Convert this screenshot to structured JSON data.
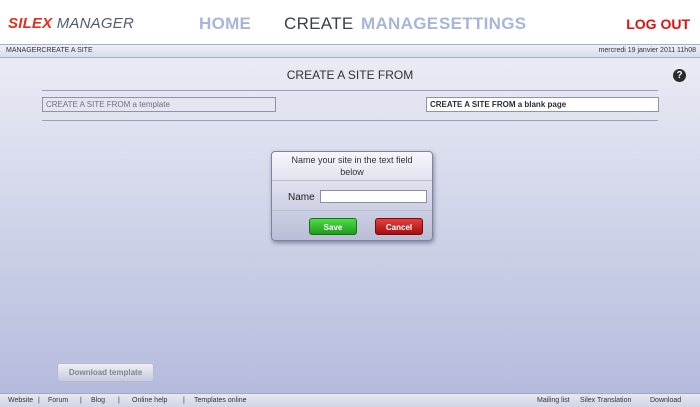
{
  "header": {
    "logo_part1": "SILEX",
    "logo_part2": "MANAGER",
    "nav": {
      "home": "HOME",
      "create": "CREATE",
      "manage": "MANAGE",
      "settings": "SETTINGS"
    },
    "logout": "LOG OUT",
    "active_tab": "create"
  },
  "breadcrumb": {
    "root": "MANAGER",
    "current": "CREATE A SITE",
    "date": "mercredi 19 janvier 2011 11h08"
  },
  "create": {
    "title": "CREATE A SITE FROM",
    "help": "?",
    "options": {
      "template": "CREATE A SITE FROM a template",
      "blank": "CREATE A SITE FROM a blank page"
    }
  },
  "dialog": {
    "message_line1": "Name your site in the text field",
    "message_line2": "below",
    "name_label": "Name",
    "name_value": "",
    "save_label": "Save",
    "cancel_label": "Cancel"
  },
  "download_button": "Download template",
  "footer": {
    "left": {
      "website": "Website",
      "sep": "|",
      "forum": "Forum",
      "blog": "Blog",
      "online_help": "Online help",
      "templates_online": "Templates online"
    },
    "right": {
      "mailing_list": "Mailing list",
      "silex_translation": "Silex Translation",
      "download": "Download"
    }
  },
  "colors": {
    "logo_red": "#e0301e",
    "nav_inactive": "#a7b6d6",
    "logout_red": "#e01010",
    "save_green": "#1f9c1c",
    "cancel_red": "#a80e0e"
  }
}
